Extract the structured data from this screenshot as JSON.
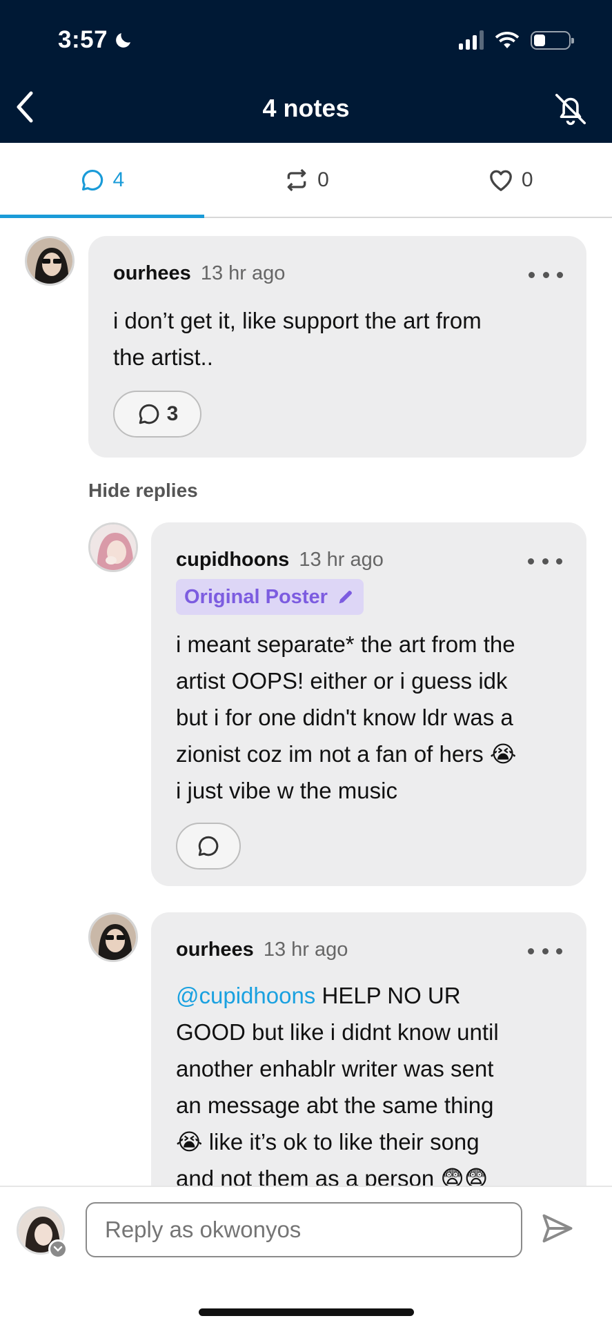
{
  "status_bar": {
    "time": "3:57"
  },
  "header": {
    "title": "4 notes"
  },
  "tabs": [
    {
      "name": "comments",
      "count": "4"
    },
    {
      "name": "reblogs",
      "count": "0"
    },
    {
      "name": "likes",
      "count": "0"
    }
  ],
  "comments": [
    {
      "username": "ourhees",
      "time": "13 hr ago",
      "lines": [
        "i don’t get it, like support the art from",
        "the artist.."
      ],
      "reply_count": "3"
    },
    {
      "username": "cupidhoons",
      "time": "13 hr ago",
      "badge": "Original Poster",
      "lines": [
        "i meant separate* the art from the",
        "artist OOPS! either or i guess idk",
        "but i for one didn't know ldr was a",
        "zionist coz im not a fan of hers 😭",
        "i just vibe w the music"
      ]
    },
    {
      "username": "ourhees",
      "time": "13 hr ago",
      "mention": "@cupidhoons",
      "lines": [
        " HELP NO UR",
        "GOOD but like i didnt know until",
        "another enhablr writer was sent",
        "an message abt the same thing",
        "😭 like it’s ok to like their song",
        "and not them as a person 😨😨"
      ]
    }
  ],
  "hide_replies_label": "Hide replies",
  "reply_box": {
    "placeholder": "Reply as okwonyos"
  },
  "colors": {
    "header_bg": "#001935",
    "accent": "#1a9bd8",
    "bubble": "#ededee",
    "op_badge_bg": "#ddd6f6",
    "op_badge_text": "#7c5ce0"
  }
}
